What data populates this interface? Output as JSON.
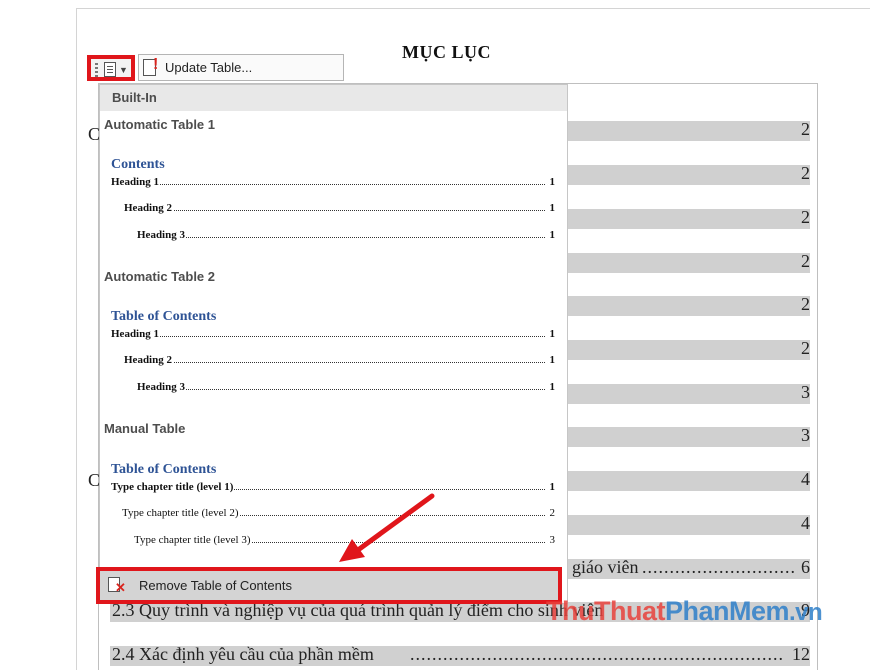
{
  "document": {
    "title": "MỤC LỤC",
    "stray_letter": "C",
    "toc_lines": [
      {
        "num": "2"
      },
      {
        "num": "2"
      },
      {
        "num": "2"
      },
      {
        "num": "2"
      },
      {
        "num": "2"
      },
      {
        "num": "2"
      },
      {
        "num": "3"
      },
      {
        "num": "3"
      },
      {
        "num": "4"
      },
      {
        "num": "4"
      },
      {
        "text": "giáo viên",
        "num": "6"
      },
      {
        "text": "2.3 Quy trình và nghiệp vụ của quá trình quản lý điểm cho sinh viên",
        "num": "9"
      },
      {
        "text": "2.4 Xác định yêu cầu của phần mềm",
        "num": "12"
      }
    ]
  },
  "toolbar": {
    "toc_button_icon": "document-icon",
    "update_table_label": "Update Table..."
  },
  "menu": {
    "header": "Built-In",
    "sections": [
      {
        "title": "Automatic Table 1",
        "gallery_title": "Contents",
        "rows": [
          {
            "text": "Heading 1",
            "num": "1"
          },
          {
            "text": "Heading 2",
            "num": "1"
          },
          {
            "text": "Heading 3",
            "num": "1"
          }
        ]
      },
      {
        "title": "Automatic Table 2",
        "gallery_title": "Table of Contents",
        "rows": [
          {
            "text": "Heading 1",
            "num": "1"
          },
          {
            "text": "Heading 2",
            "num": "1"
          },
          {
            "text": "Heading 3",
            "num": "1"
          }
        ]
      },
      {
        "title": "Manual Table",
        "gallery_title": "Table of Contents",
        "rows": [
          {
            "text": "Type chapter title (level 1)",
            "num": "1"
          },
          {
            "text": "Type chapter title (level 2)",
            "num": "2"
          },
          {
            "text": "Type chapter title (level 3)",
            "num": "3"
          }
        ]
      }
    ],
    "remove_label": "Remove Table of Contents"
  },
  "watermark": {
    "part1": "ThuThuat",
    "part2": "PhanMem",
    "part3": ".vn"
  },
  "colors": {
    "highlight_red": "#e0161b",
    "heading_blue": "#2e5395",
    "field_shade": "#d0d0d0"
  }
}
